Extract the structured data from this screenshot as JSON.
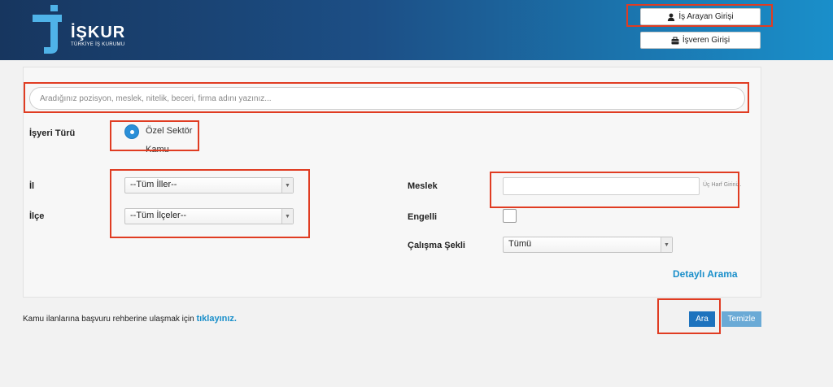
{
  "header": {
    "brand": "İŞKUR",
    "subtitle": "TÜRKİYE İŞ KURUMU",
    "job_seeker_login": "İş Arayan Girişi",
    "employer_login": "İşveren Girişi"
  },
  "search": {
    "placeholder": "Aradığınız pozisyon, meslek, nitelik, beceri, firma adını yazınız..."
  },
  "filters": {
    "workplace_type_label": "İşyeri Türü",
    "workplace_options": [
      "Özel Sektör",
      "Kamu"
    ],
    "workplace_selected": "Özel Sektör",
    "il_label": "İl",
    "il_value": "--Tüm İller--",
    "ilce_label": "İlçe",
    "ilce_value": "--Tüm İlçeler--",
    "meslek_label": "Meslek",
    "meslek_hint": "Üç Harf Giriniz.",
    "engelli_label": "Engelli",
    "engelli_checked": false,
    "calisma_label": "Çalışma Şekli",
    "calisma_value": "Tümü",
    "detailed_search": "Detaylı Arama"
  },
  "footer": {
    "note_text": "Kamu ilanlarına başvuru rehberine ulaşmak için ",
    "note_link": "tıklayınız.",
    "search_button": "Ara",
    "clear_button": "Temizle"
  },
  "colors": {
    "header_start": "#17365f",
    "header_end": "#1a8fca",
    "accent": "#1a8fca",
    "primary_button": "#1e73be",
    "highlight": "#e03c22"
  }
}
